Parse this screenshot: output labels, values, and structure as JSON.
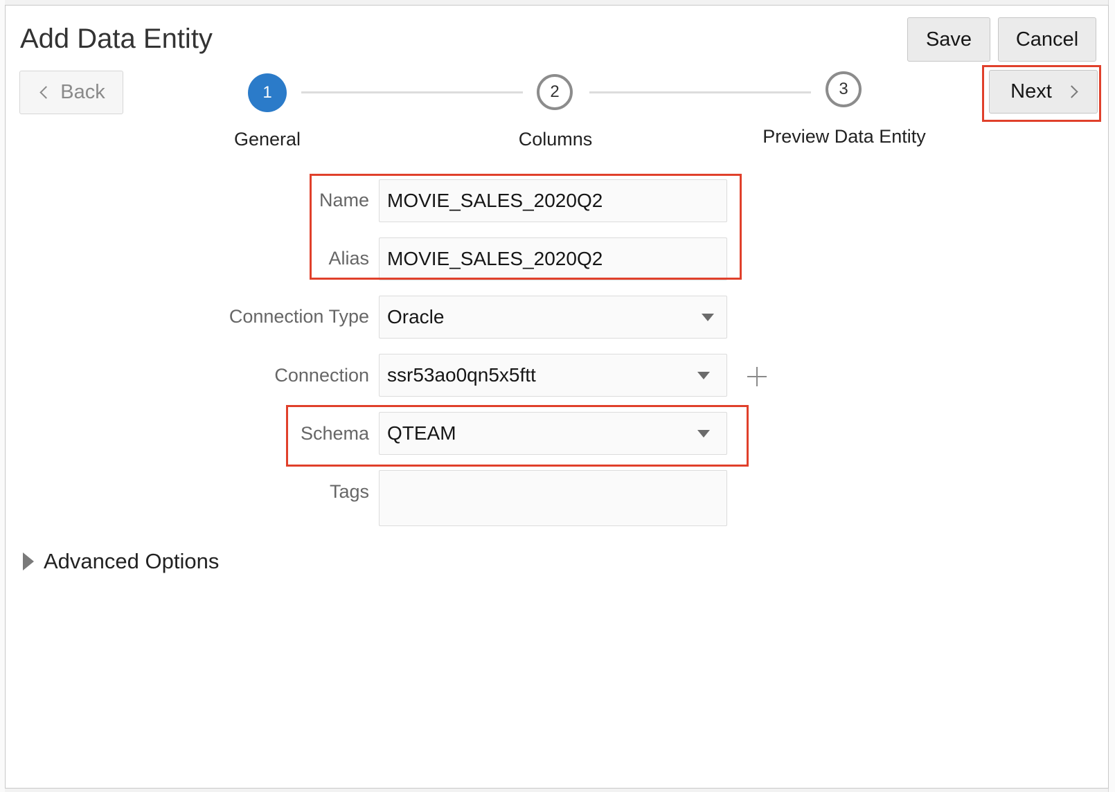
{
  "dialog": {
    "title": "Add Data Entity"
  },
  "toolbar": {
    "save_label": "Save",
    "cancel_label": "Cancel",
    "back_label": "Back",
    "next_label": "Next"
  },
  "train": {
    "steps": [
      {
        "number": "1",
        "label": "General",
        "state": "active"
      },
      {
        "number": "2",
        "label": "Columns",
        "state": "idle"
      },
      {
        "number": "3",
        "label": "Preview Data Entity",
        "state": "idle"
      }
    ]
  },
  "form": {
    "name": {
      "label": "Name",
      "value": "MOVIE_SALES_2020Q2"
    },
    "alias": {
      "label": "Alias",
      "value": "MOVIE_SALES_2020Q2"
    },
    "connection_type": {
      "label": "Connection Type",
      "value": "Oracle"
    },
    "connection": {
      "label": "Connection",
      "value": "ssr53ao0qn5x5ftt"
    },
    "schema": {
      "label": "Schema",
      "value": "QTEAM"
    },
    "tags": {
      "label": "Tags",
      "value": ""
    }
  },
  "advanced": {
    "label": "Advanced Options"
  },
  "colors": {
    "accent": "#2b7bc9",
    "highlight": "#e0402b"
  },
  "icons": [
    "chevron-left-icon",
    "chevron-right-icon",
    "caret-down-icon",
    "plus-icon",
    "expand-triangle-icon"
  ]
}
